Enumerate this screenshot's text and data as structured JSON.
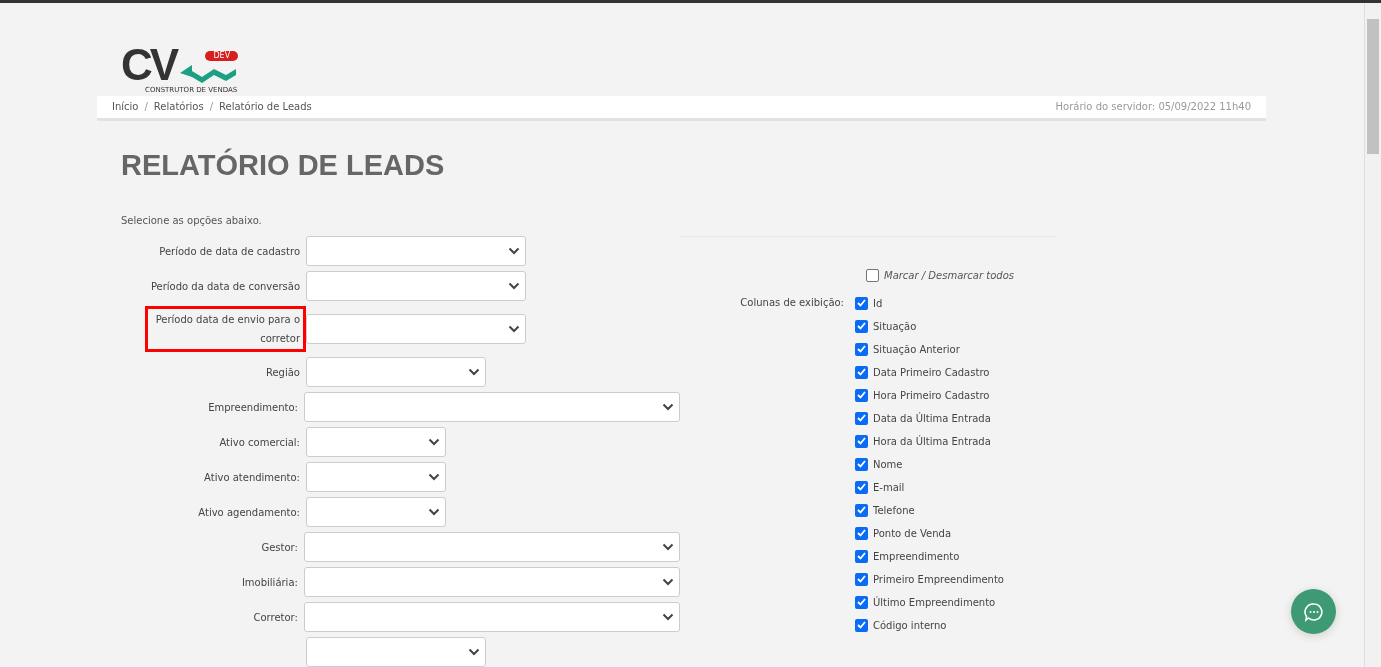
{
  "logo": {
    "letters": "CV",
    "badge": "DEV",
    "tagline": "CONSTRUTOR DE VENDAS"
  },
  "breadcrumb": [
    "Início",
    "Relatórios",
    "Relatório de Leads"
  ],
  "breadcrumb_separator": "/",
  "server_time": "Horário do servidor: 05/09/2022 11h40",
  "title": "RELATÓRIO DE LEADS",
  "subtitle": "Selecione as opções abaixo.",
  "fields": [
    {
      "label": "Período de data de cadastro",
      "kind": "medium",
      "highlighted": false
    },
    {
      "label": "Período da data de conversão",
      "kind": "medium",
      "highlighted": false
    },
    {
      "label": "Período data de envio para o corretor",
      "kind": "medium",
      "highlighted": true
    },
    {
      "label": "Região",
      "kind": "short",
      "highlighted": false
    },
    {
      "label": "Empreendimento:",
      "kind": "wide",
      "highlighted": false
    },
    {
      "label": "Ativo comercial:",
      "kind": "small",
      "highlighted": false
    },
    {
      "label": "Ativo atendimento:",
      "kind": "small",
      "highlighted": false
    },
    {
      "label": "Ativo agendamento:",
      "kind": "small",
      "highlighted": false
    },
    {
      "label": "Gestor:",
      "kind": "wide",
      "highlighted": false
    },
    {
      "label": "Imobiliária:",
      "kind": "wide",
      "highlighted": false
    },
    {
      "label": "Corretor:",
      "kind": "wide",
      "highlighted": false
    },
    {
      "kind": "short"
    }
  ],
  "toggle_all": {
    "label": "Marcar / Desmarcar todos",
    "checked": false
  },
  "columns_label": "Colunas de exibição:",
  "columns": [
    {
      "label": "Id",
      "checked": true
    },
    {
      "label": "Situação",
      "checked": true
    },
    {
      "label": "Situação Anterior",
      "checked": true
    },
    {
      "label": "Data Primeiro Cadastro",
      "checked": true
    },
    {
      "label": "Hora Primeiro Cadastro",
      "checked": true
    },
    {
      "label": "Data da Última Entrada",
      "checked": true
    },
    {
      "label": "Hora da Última Entrada",
      "checked": true
    },
    {
      "label": "Nome",
      "checked": true
    },
    {
      "label": "E-mail",
      "checked": true
    },
    {
      "label": "Telefone",
      "checked": true
    },
    {
      "label": "Ponto de Venda",
      "checked": true
    },
    {
      "label": "Empreendimento",
      "checked": true
    },
    {
      "label": "Primeiro Empreendimento",
      "checked": true
    },
    {
      "label": "Último Empreendimento",
      "checked": true
    },
    {
      "label": "Código interno",
      "checked": true
    }
  ]
}
